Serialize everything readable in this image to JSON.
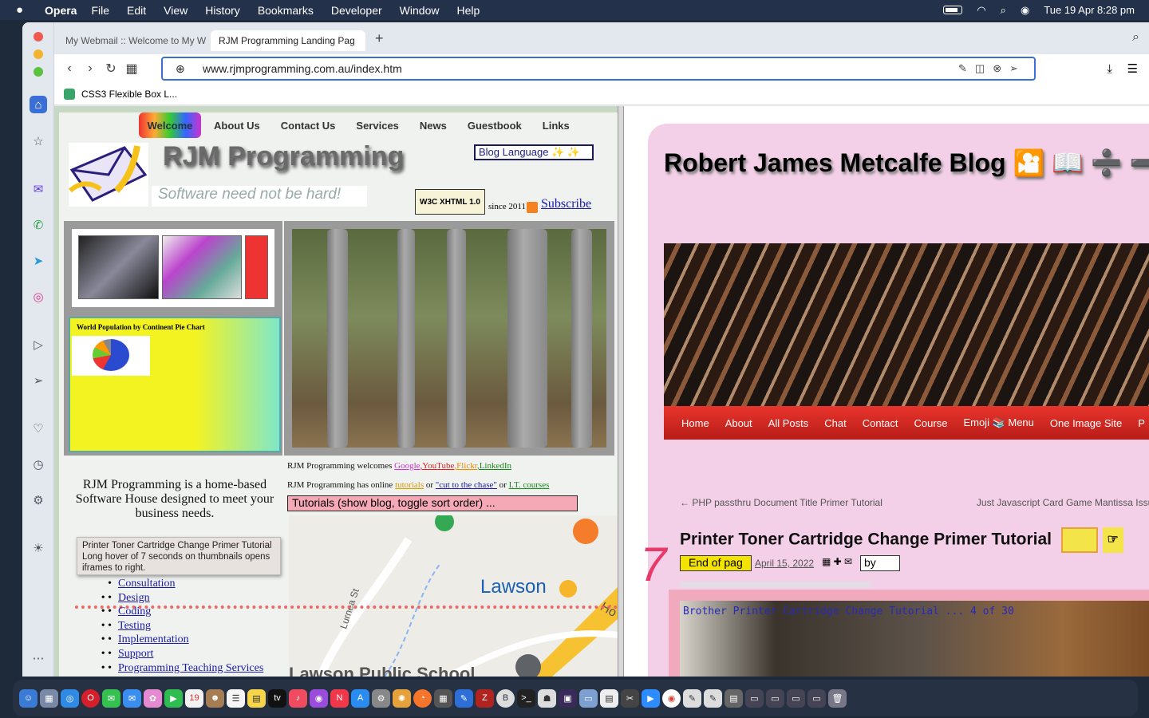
{
  "menubar": {
    "app": "Opera",
    "items": [
      "File",
      "Edit",
      "View",
      "History",
      "Bookmarks",
      "Developer",
      "Window",
      "Help"
    ],
    "clock": "Tue 19 Apr  8:28 pm"
  },
  "tabs": [
    {
      "label": "My Webmail :: Welcome to My W"
    },
    {
      "label": "RJM Programming Landing Pag"
    }
  ],
  "address": {
    "url": "www.rjmprogramming.com.au/index.htm"
  },
  "bookmarks": [
    {
      "label": "CSS3 Flexible Box L..."
    }
  ],
  "left": {
    "nav": [
      "Welcome",
      "About Us",
      "Contact Us",
      "Services",
      "News",
      "Guestbook",
      "Links"
    ],
    "brand": "RJM Programming",
    "slogan": "Software need not be hard!",
    "lang_select": "Blog Language ✨ ✨",
    "w3c": "W3C XHTML 1.0",
    "since": "since 2011",
    "subscribe": "Subscribe",
    "pie_title": "World Population by Continent Pie Chart",
    "welcomes_prefix": "RJM Programming welcomes ",
    "welcomes_links": [
      "Google",
      ",YouTube",
      ",Flickr",
      ",LinkedIn"
    ],
    "online_prefix": "RJM Programming has online ",
    "online_tutorials": "tutorials",
    "online_or1": " or ",
    "online_cut": "\"cut to the chase\"",
    "online_or2": " or ",
    "online_it": "I.T. courses",
    "tutorials_select": "Tutorials (show blog, toggle sort order) ...",
    "software_house": "RJM Programming is a home-based Software House designed to meet your business needs.",
    "tooltip": "Printer Toner Cartridge Change Primer Tutorial Long hover of 7 seconds on thumbnails opens iframes to right.",
    "services": [
      "Consultation",
      "Design",
      "Coding",
      "Testing",
      "Implementation",
      "Support",
      "Programming Teaching Services"
    ],
    "map": {
      "place": "Lawson",
      "street": "Lurnea St",
      "school": "Lawson Public School",
      "road": "Ho"
    }
  },
  "right": {
    "blog_title": "Robert James Metcalfe Blog 🎦 📖 ➗ ➖",
    "nav": [
      "Home",
      "About",
      "All Posts",
      "Chat",
      "Contact",
      "Course",
      "Emoji 📚 Menu",
      "One Image Site",
      "P"
    ],
    "prev": "← PHP passthru Document Title Primer Tutorial",
    "next": "Just Javascript Card Game Mantissa Issue",
    "post_title": "Printer Toner Cartridge Change Primer Tutorial",
    "end_select": "End of pag",
    "post_date": "April 15, 2022",
    "by_select": "by",
    "photo_caption": "Brother Printer Cartridge Change Tutorial ... 4 of 30"
  },
  "colors": {
    "accent": "#3b6fd6",
    "blognav": "#d92a22",
    "blogbg": "#f4d0e8"
  }
}
